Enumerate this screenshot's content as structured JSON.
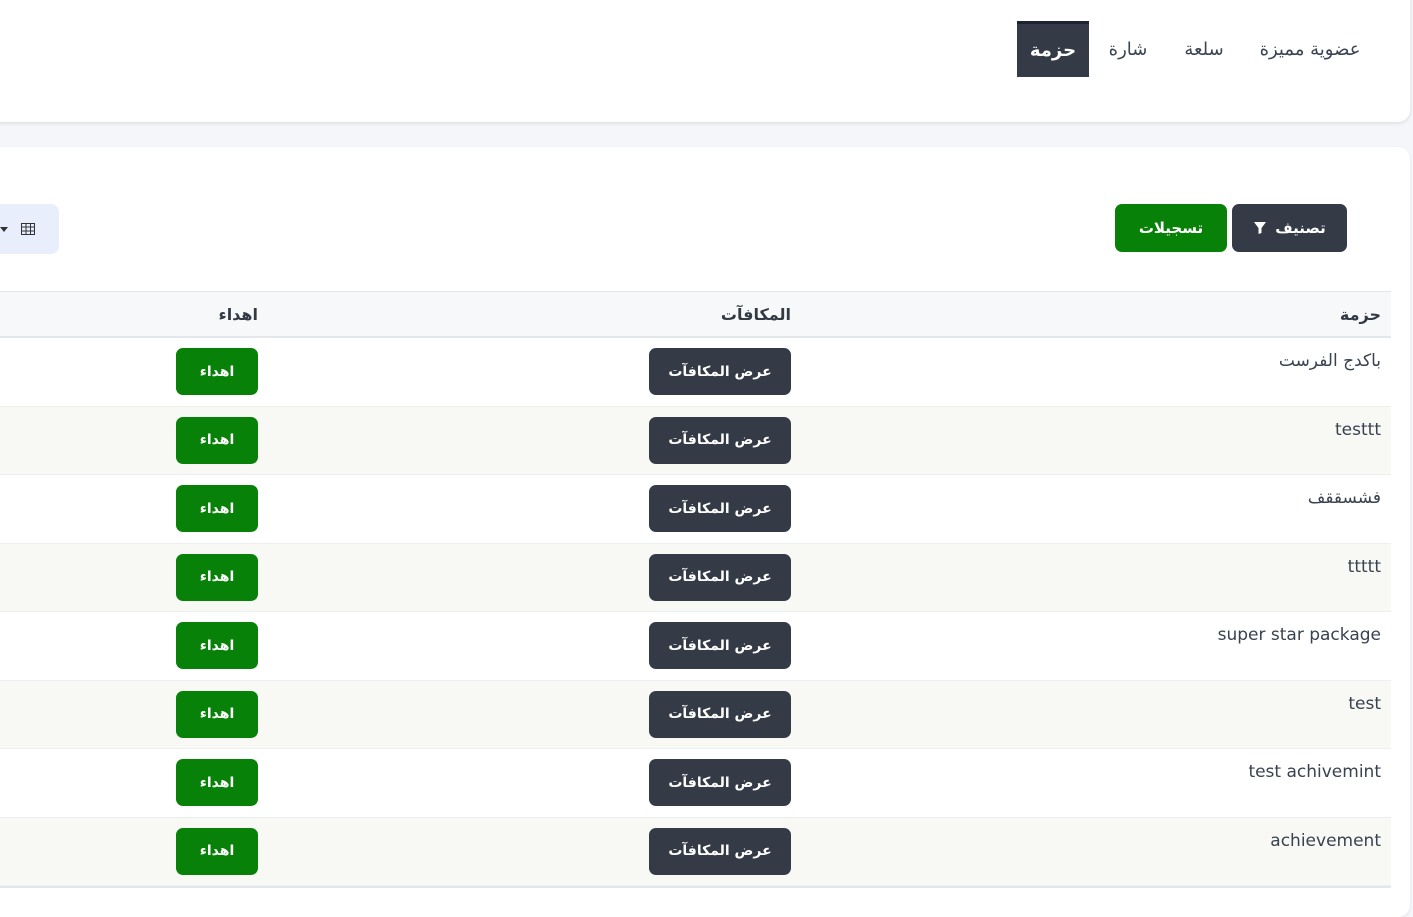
{
  "tabs": [
    {
      "label": "عضوية مميزة",
      "active": false
    },
    {
      "label": "سلعة",
      "active": false
    },
    {
      "label": "شارة",
      "active": false
    },
    {
      "label": "حزمة",
      "active": true
    }
  ],
  "toolbar": {
    "filter_label": "تصنيف",
    "records_label": "تسجيلات",
    "view_icon": "grid-icon"
  },
  "table": {
    "headers": {
      "name": "حزمة",
      "rewards": "المكافآت",
      "gift": "اهداء"
    },
    "rows": [
      {
        "name": "باكدج الفرست",
        "rewards_label": "عرض المكافآت",
        "gift_label": "اهداء"
      },
      {
        "name": "testtt",
        "rewards_label": "عرض المكافآت",
        "gift_label": "اهداء"
      },
      {
        "name": "فشسققف",
        "rewards_label": "عرض المكافآت",
        "gift_label": "اهداء"
      },
      {
        "name": "ttttt",
        "rewards_label": "عرض المكافآت",
        "gift_label": "اهداء"
      },
      {
        "name": "super star package",
        "rewards_label": "عرض المكافآت",
        "gift_label": "اهداء"
      },
      {
        "name": "test",
        "rewards_label": "عرض المكافآت",
        "gift_label": "اهداء"
      },
      {
        "name": "test achivemint",
        "rewards_label": "عرض المكافآت",
        "gift_label": "اهداء"
      },
      {
        "name": "achievement",
        "rewards_label": "عرض المكافآت",
        "gift_label": "اهداء"
      }
    ]
  },
  "colors": {
    "dark_button": "#343a46",
    "green_button": "#078107",
    "active_tab": "#343a46"
  }
}
